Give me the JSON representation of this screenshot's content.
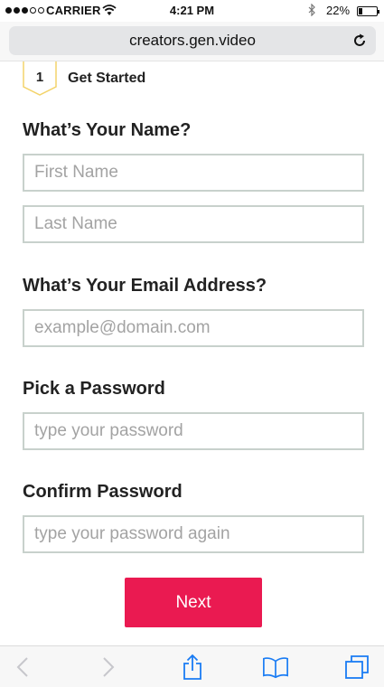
{
  "status_bar": {
    "carrier": "CARRIER",
    "time": "4:21 PM",
    "battery_percent": "22%",
    "battery_level": 0.22,
    "signal_bars": 3
  },
  "browser": {
    "url": "creators.gen.video"
  },
  "step": {
    "number": "1",
    "title": "Get Started",
    "accent_color": "#f3d36b"
  },
  "form": {
    "name_label": "What’s Your Name?",
    "first_name_placeholder": "First Name",
    "last_name_placeholder": "Last Name",
    "email_label": "What’s Your Email Address?",
    "email_placeholder": "example@domain.com",
    "password_label": "Pick a Password",
    "password_placeholder": "type your password",
    "confirm_label": "Confirm Password",
    "confirm_placeholder": "type your password again",
    "next_label": "Next",
    "button_color": "#ea1a51"
  },
  "toolbar": {
    "icons": [
      "back-icon",
      "forward-icon",
      "share-icon",
      "bookmarks-icon",
      "tabs-icon"
    ],
    "active_color": "#1a7cf4",
    "disabled_color": "#c7c7cc"
  }
}
